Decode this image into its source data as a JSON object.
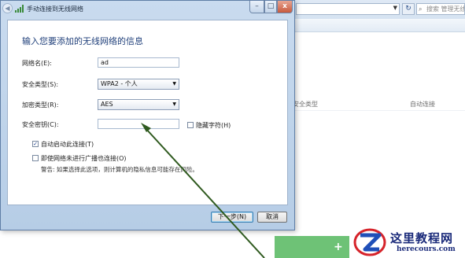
{
  "explorer": {
    "search_placeholder": "搜索 管理无线网络",
    "columns": [
      "安全类型",
      "自动连接"
    ],
    "refresh_icon": "refresh-icon",
    "search_icon": "search-icon"
  },
  "dialog": {
    "title": "手动连接到无线网络",
    "heading": "输入您要添加的无线网络的信息",
    "window_buttons": {
      "minimize": "–",
      "maximize": "□",
      "close": "x"
    },
    "fields": {
      "network_name": {
        "label": "网络名(E):",
        "value": "ad"
      },
      "security_type": {
        "label": "安全类型(S):",
        "value": "WPA2 - 个人"
      },
      "encryption_type": {
        "label": "加密类型(R):",
        "value": "AES"
      },
      "security_key": {
        "label": "安全密钥(C):",
        "value": ""
      }
    },
    "hide_chars": {
      "label": "隐藏字符(H)",
      "checked": false
    },
    "auto_connect": {
      "label": "自动启动此连接(T)",
      "checked": true
    },
    "connect_not_broadcasting": {
      "label": "即使网络未进行广播也连接(O)",
      "checked": false
    },
    "warning": "警告: 如果选择此选项，则计算机的隐私信息可能存在风险。",
    "buttons": {
      "next": "下一步(N)",
      "cancel": "取消"
    }
  },
  "watermark": {
    "title": "这里教程网",
    "url": "herecours.com"
  },
  "colors": {
    "heading": "#1f3f7a",
    "annotation_arrow": "#2f5a1f",
    "watermark_text": "#1a2a7a",
    "watermark_red": "#d6232a",
    "watermark_blue": "#1f4fb8"
  }
}
